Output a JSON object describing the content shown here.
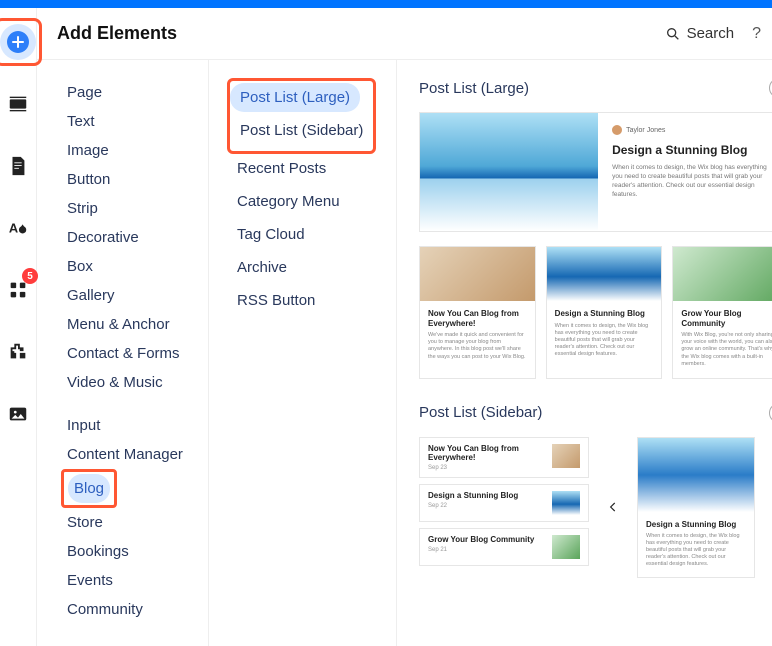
{
  "panel_title": "Add Elements",
  "header": {
    "search_label": "Search",
    "help_label": "?",
    "close_label": "✕"
  },
  "rail": {
    "badge_apps": "5"
  },
  "categories": {
    "group1": [
      "Page",
      "Text",
      "Image",
      "Button",
      "Strip",
      "Decorative",
      "Box",
      "Gallery",
      "Menu & Anchor",
      "Contact & Forms",
      "Video & Music"
    ],
    "group2": [
      "Input",
      "Content Manager",
      "Blog",
      "Store",
      "Bookings",
      "Events",
      "Community"
    ],
    "selected": "Blog"
  },
  "subitems": {
    "items": [
      "Post List (Large)",
      "Post List (Sidebar)",
      "Recent Posts",
      "Category Menu",
      "Tag Cloud",
      "Archive",
      "RSS Button"
    ],
    "selected": "Post List (Large)"
  },
  "preview": {
    "large": {
      "title": "Post List (Large)",
      "card": {
        "author": "Taylor Jones",
        "heading": "Design a Stunning Blog",
        "body": "When it comes to design, the Wix blog has everything you need to create beautiful posts that will grab your reader's attention. Check out our essential design features."
      },
      "row": [
        {
          "heading": "Now You Can Blog from Everywhere!",
          "body": "We've made it quick and convenient for you to manage your blog from anywhere. In this blog post we'll share the ways you can post to your Wix Blog."
        },
        {
          "heading": "Design a Stunning Blog",
          "body": "When it comes to design, the Wix blog has everything you need to create beautiful posts that will grab your reader's attention. Check out our essential design features."
        },
        {
          "heading": "Grow Your Blog Community",
          "body": "With Wix Blog, you're not only sharing your voice with the world, you can also grow an online community. That's why the Wix blog comes with a built-in members."
        }
      ]
    },
    "sidebar": {
      "title": "Post List (Sidebar)",
      "list": [
        {
          "heading": "Now You Can Blog from Everywhere!",
          "date": "Sep 23"
        },
        {
          "heading": "Design a Stunning Blog",
          "date": "Sep 22"
        },
        {
          "heading": "Grow Your Blog Community",
          "date": "Sep 21"
        }
      ],
      "feature": {
        "heading": "Design a Stunning Blog",
        "body": "When it comes to design, the Wix blog has everything you need to create beautiful posts that will grab your reader's attention. Check out our essential design features."
      }
    }
  }
}
